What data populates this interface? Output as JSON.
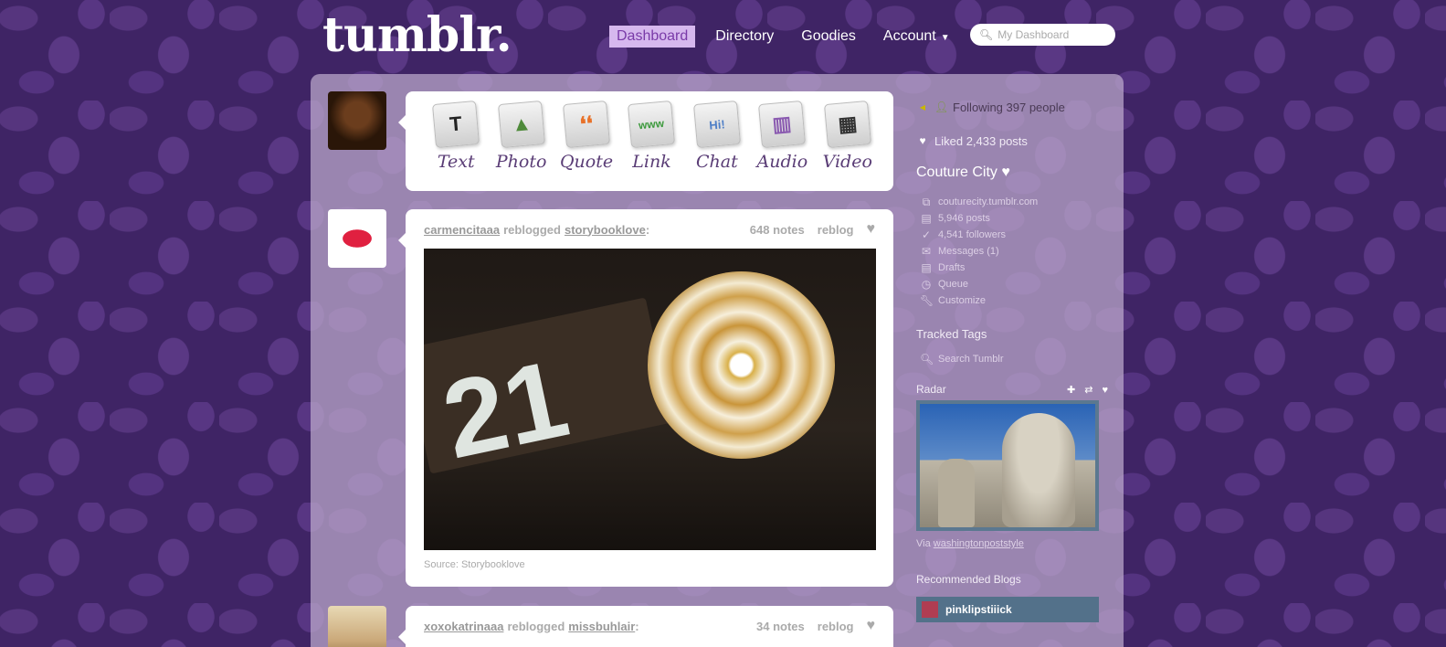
{
  "header": {
    "logo": "tumblr.",
    "nav": [
      {
        "label": "Dashboard",
        "active": true
      },
      {
        "label": "Directory",
        "active": false
      },
      {
        "label": "Goodies",
        "active": false
      },
      {
        "label": "Account",
        "active": false
      }
    ],
    "search_placeholder": "My Dashboard"
  },
  "post_types": [
    {
      "label": "Text",
      "glyph": "T",
      "color": "#222222"
    },
    {
      "label": "Photo",
      "glyph": "▲",
      "color": "#4e8a3a"
    },
    {
      "label": "Quote",
      "glyph": "❛❛",
      "color": "#e8722a"
    },
    {
      "label": "Link",
      "glyph": "www",
      "color": "#3d9a3d"
    },
    {
      "label": "Chat",
      "glyph": "Hi!",
      "color": "#4f7fc7"
    },
    {
      "label": "Audio",
      "glyph": "▥",
      "color": "#8a5ab0"
    },
    {
      "label": "Video",
      "glyph": "▦",
      "color": "#333333"
    }
  ],
  "posts": [
    {
      "author": "carmencitaaa",
      "action": "reblogged",
      "source_blog": "storybooklove",
      "notes": "648 notes",
      "reblog": "reblog",
      "image_text": "21",
      "source": "Source: Storybooklove"
    },
    {
      "author": "xoxokatrinaaa",
      "action": "reblogged",
      "source_blog": "missbuhlair",
      "notes": "34 notes",
      "reblog": "reblog"
    }
  ],
  "sidebar": {
    "following": "Following 397 people",
    "liked": "Liked 2,433 posts",
    "blog_title": "Couture City ♥",
    "blog_links": [
      {
        "label": "couturecity.tumblr.com",
        "icon": "external-link-icon"
      },
      {
        "label": "5,946 posts",
        "icon": "document-icon"
      },
      {
        "label": "4,541 followers",
        "icon": "check-icon"
      },
      {
        "label": "Messages (1)",
        "icon": "envelope-icon"
      },
      {
        "label": "Drafts",
        "icon": "document-icon"
      },
      {
        "label": "Queue",
        "icon": "clock-icon"
      },
      {
        "label": "Customize",
        "icon": "wrench-icon"
      }
    ],
    "tracked_tags_title": "Tracked Tags",
    "search_tumblr": "Search Tumblr",
    "radar_title": "Radar",
    "radar_via_prefix": "Via",
    "radar_via_blog": "washingtonpoststyle",
    "recommended_title": "Recommended Blogs",
    "recommended": [
      {
        "name": "pinklipstiiick"
      }
    ]
  },
  "colors": {
    "accent": "#d6b8ee",
    "accent_text": "#7a3ba8",
    "background": "#3f2465"
  }
}
